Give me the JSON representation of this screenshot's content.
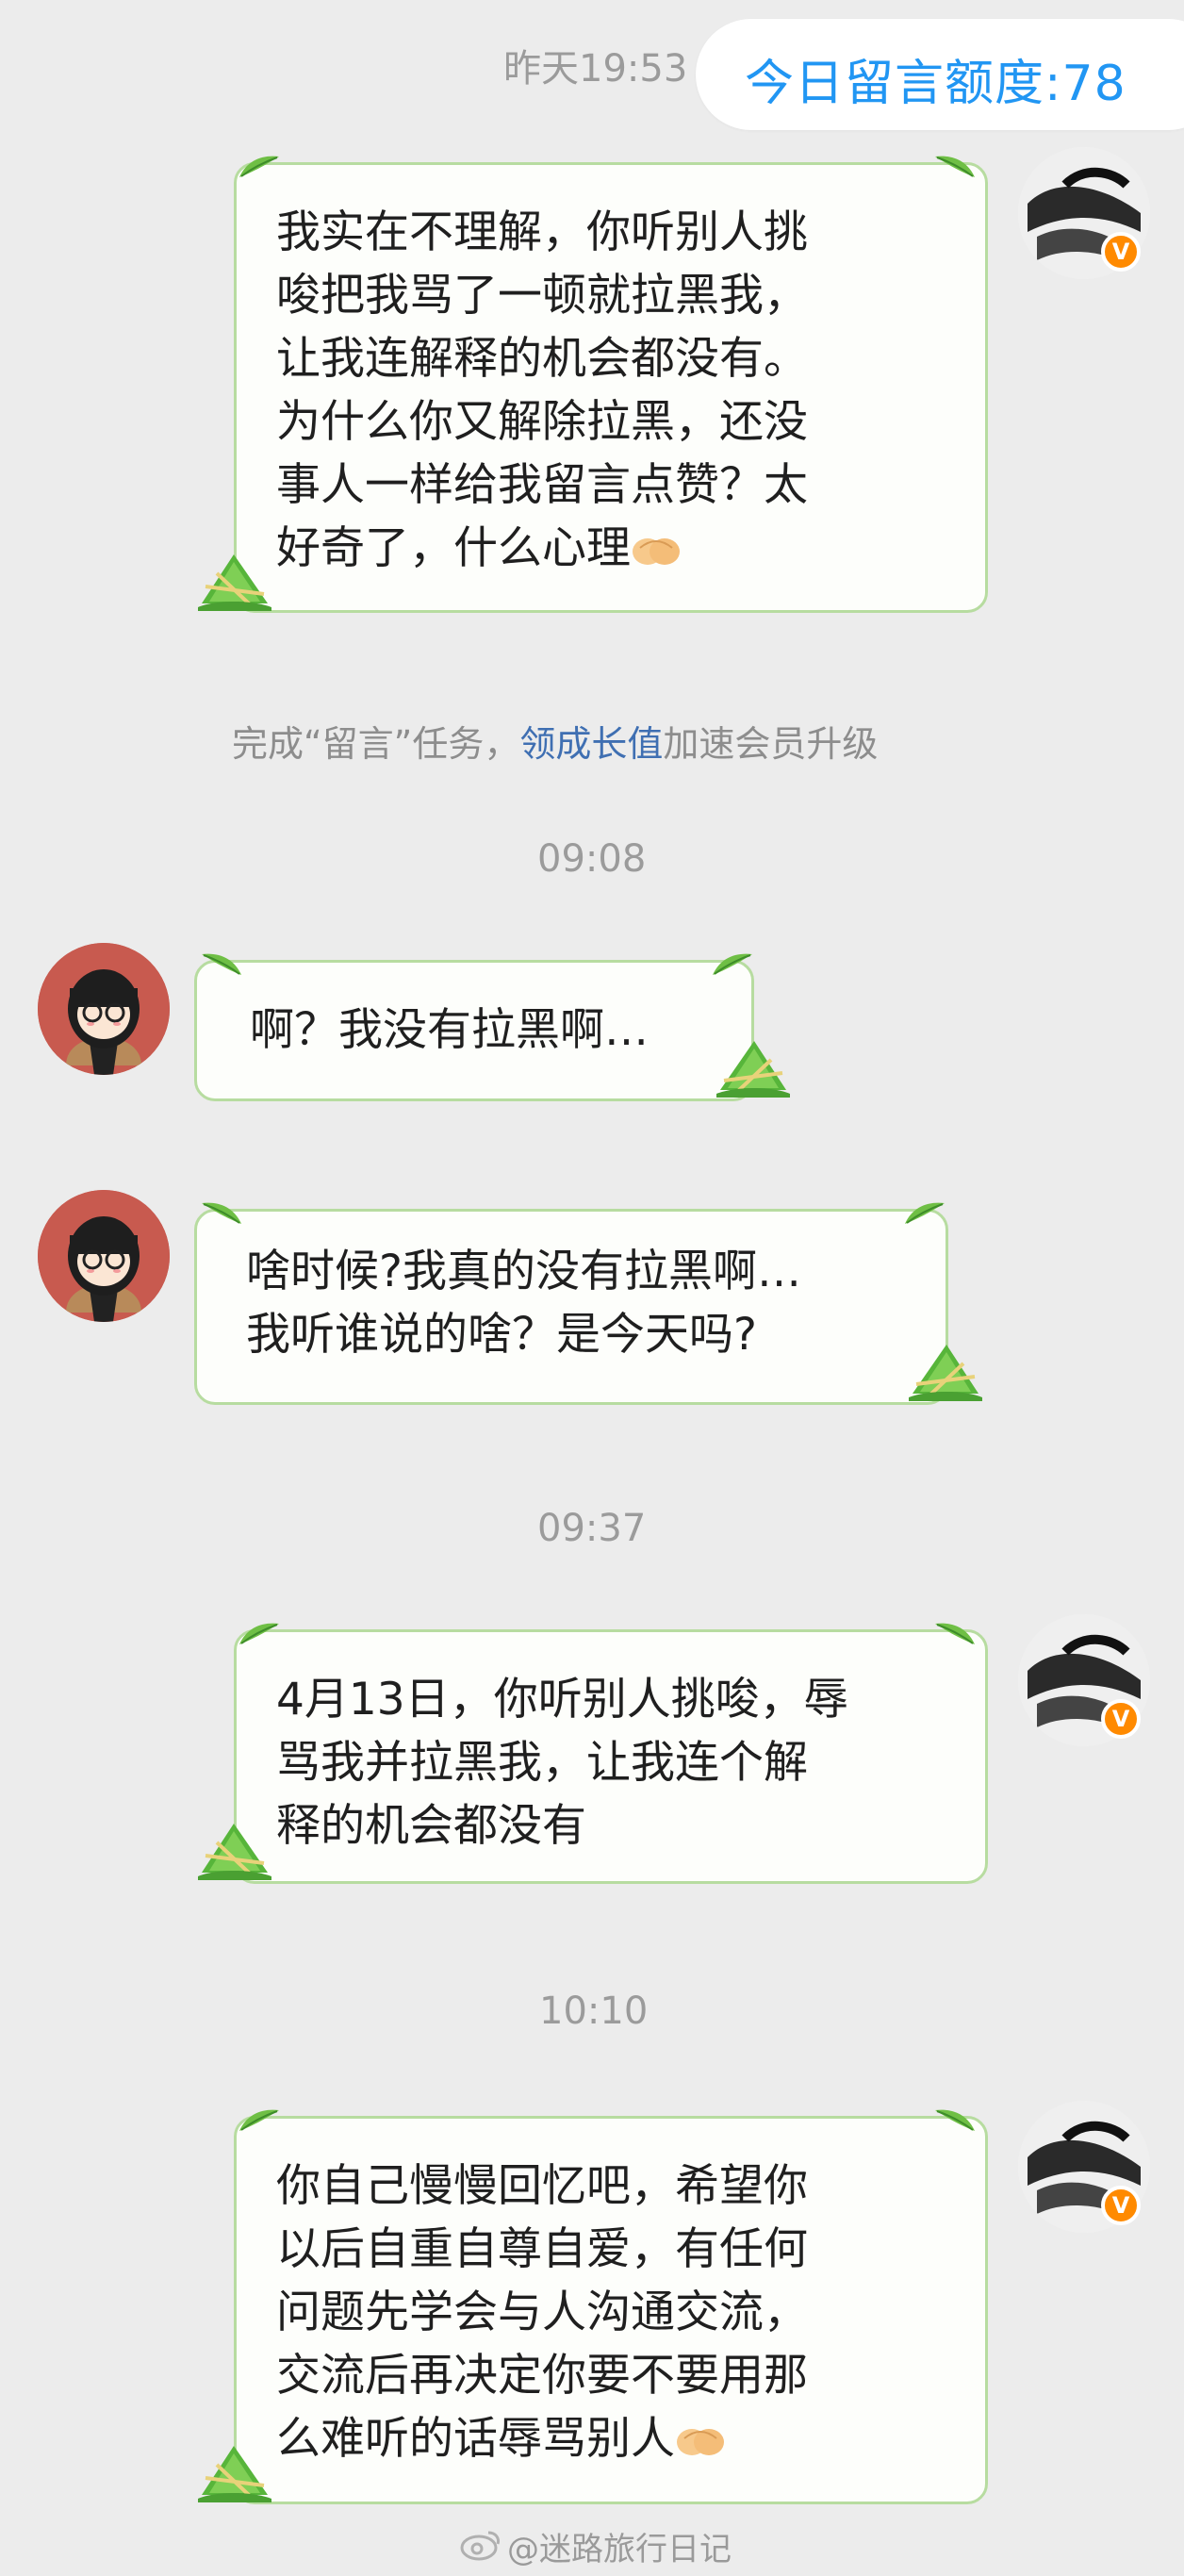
{
  "header": {
    "yesterday_timestamp": "昨天19:53",
    "quota_label": "今日留言额度:78"
  },
  "system_note": {
    "prefix": "完成“留言”任务，",
    "link": "领成长值",
    "suffix": "加速会员升级"
  },
  "timestamps": [
    "09:08",
    "09:37",
    "10:10"
  ],
  "messages": [
    {
      "side": "right",
      "text": "我实在不理解，你听别人挑\n唆把我骂了一顿就拉黑我，\n让我连解释的机会都没有。\n为什么你又解除拉黑，还没\n事人一样给我留言点赞？太\n好奇了，什么心理"
    },
    {
      "side": "left",
      "text": "啊？我没有拉黑啊…"
    },
    {
      "side": "left",
      "text": "啥时候?我真的没有拉黑啊…\n我听谁说的啥？是今天吗?"
    },
    {
      "side": "right",
      "text": "4月13日，你听别人挑唆，辱\n骂我并拉黑我，让我连个解\n释的机会都没有"
    },
    {
      "side": "right",
      "text": "你自己慢慢回忆吧，希望你\n以后自重自尊自爱，有任何\n问题先学会与人沟通交流，\n交流后再决定你要不要用那\n么难听的话辱骂别人"
    }
  ],
  "icons": {
    "gesture": "ok-hand-emoji",
    "badge": "v-verified-badge",
    "leaf": "bamboo-leaf-icon",
    "zongzi": "zongzi-icon"
  },
  "badge_letter": "V",
  "watermark": "@迷路旅行日记",
  "colors": {
    "background": "#ececec",
    "bubble_border": "#b7dca0",
    "bubble_fill": "#fdfefb",
    "quota_text": "#2196f3",
    "link": "#3f6fb2",
    "badge": "#ff8a00"
  }
}
